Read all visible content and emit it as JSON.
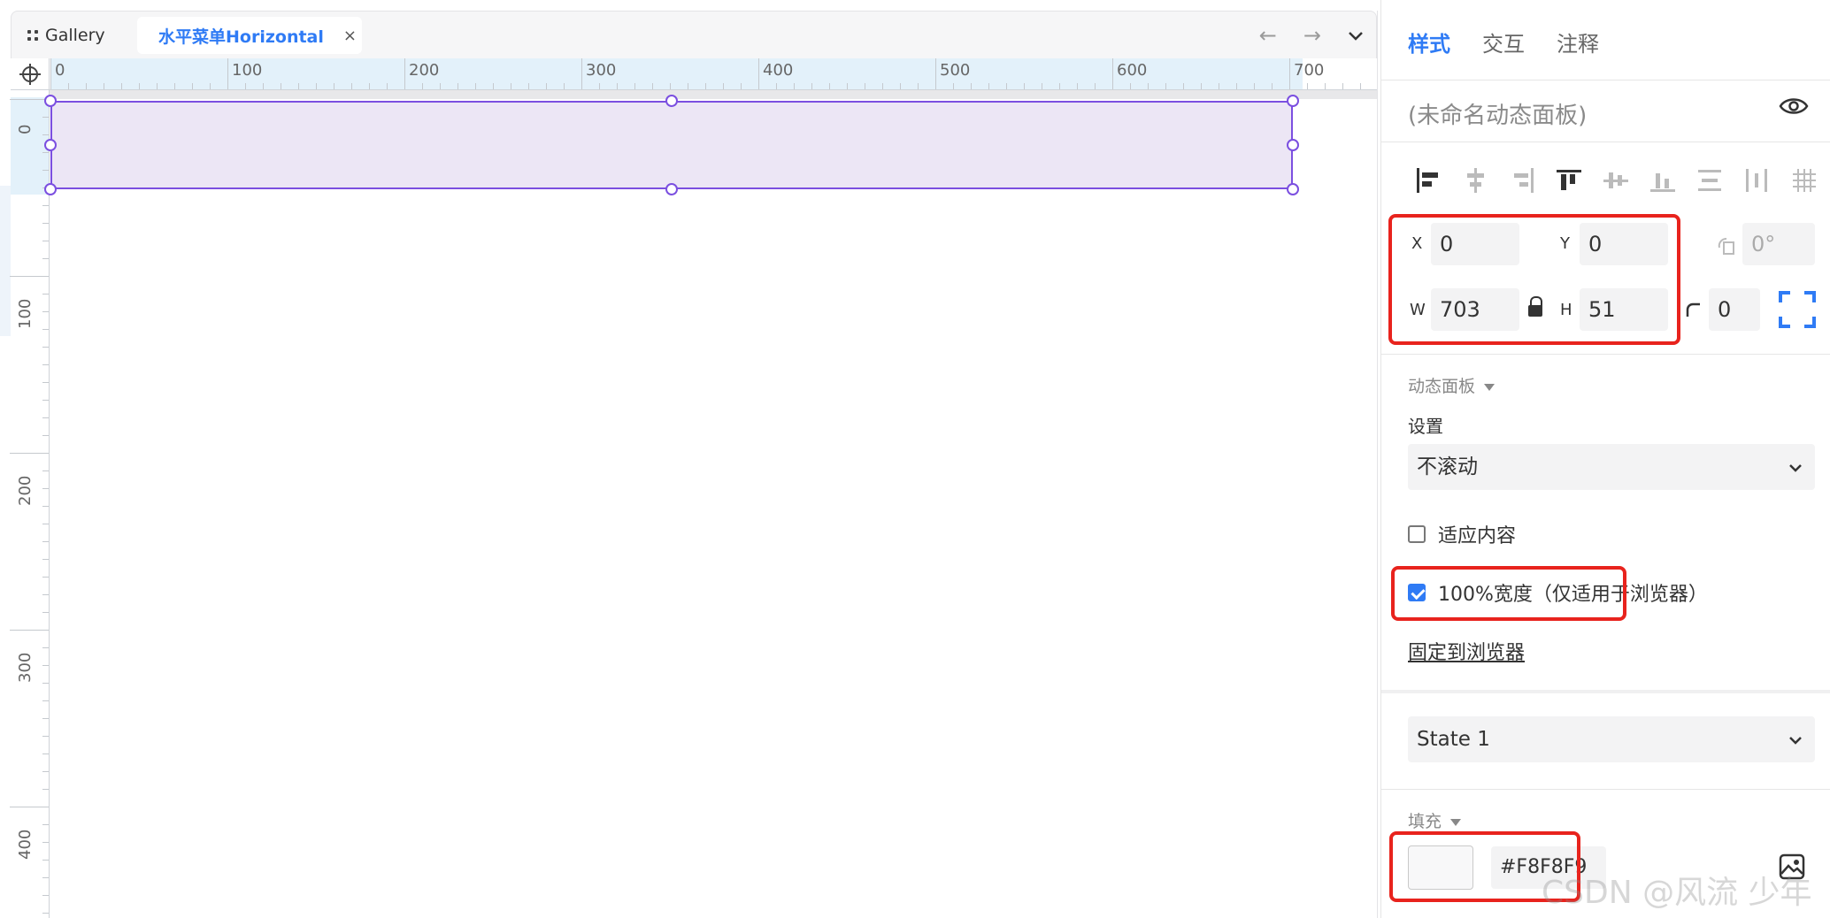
{
  "tabs": {
    "gallery_label": "Gallery",
    "active_label": "水平菜单Horizontal",
    "close_symbol": "×"
  },
  "nav": {
    "back_symbol": "←",
    "forward_symbol": "→",
    "menu_symbol": "⌄"
  },
  "ruler": {
    "x_labels": [
      "0",
      "100",
      "200",
      "300",
      "400",
      "500",
      "600",
      "700"
    ],
    "y_labels": [
      "0",
      "100",
      "200",
      "300",
      "400"
    ]
  },
  "props": {
    "tab_style": "样式",
    "tab_interact": "交互",
    "tab_notes": "注释",
    "name_placeholder": "(未命名动态面板)",
    "x_label": "X",
    "x_value": "0",
    "y_label": "Y",
    "y_value": "0",
    "w_label": "W",
    "w_value": "703",
    "h_label": "H",
    "h_value": "51",
    "rotation_value": "0°",
    "radius_value": "0",
    "section_dynamic_panel": "动态面板",
    "settings_label": "设置",
    "scroll_select": "不滚动",
    "fit_content_label": "适应内容",
    "fit_content_checked": false,
    "full_width_label": "100%宽度（仅适用于浏览器）",
    "full_width_checked": true,
    "pin_link": "固定到浏览器",
    "state_select": "State 1",
    "section_fill": "填充",
    "fill_hex": "#F8F8F9",
    "accent_color": "#2f7bf5",
    "selection_color": "#7b4fe0",
    "highlight_color": "#e8231d"
  },
  "watermark": "CSDN @风流 少年"
}
